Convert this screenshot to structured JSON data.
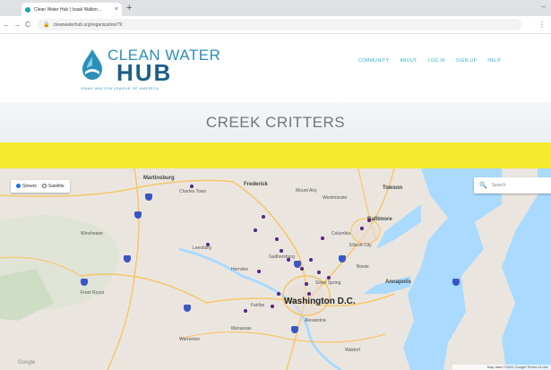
{
  "browser": {
    "tab_title": "Clean Water Hub | Izaak Walton...",
    "tab_close": "×",
    "new_tab": "+",
    "window_controls": "–",
    "url": "cleanwaterhub.org/organization/79",
    "nav_back": "←",
    "nav_forward": "→",
    "nav_reload": "C",
    "lock": "🔒",
    "menu": "⋮"
  },
  "site": {
    "logo_top": "CLEAN WATER",
    "logo_hub": "HUB",
    "logo_sub": "IZAAK WALTON LEAGUE OF AMERICA",
    "nav": [
      "COMMUNITY",
      "ABOUT",
      "LOG IN",
      "SIGN UP",
      "HELP"
    ],
    "brand_color": "#1d5f86",
    "accent_color": "#2ab0cf"
  },
  "banner": {
    "title": "CREEK CRITTERS",
    "band_color": "#f3e92e"
  },
  "map": {
    "type_options": [
      "Streets",
      "Satellite"
    ],
    "selected_type": "Streets",
    "search_placeholder": "Search",
    "search_icon": "magnifier-icon",
    "labels": {
      "martinsburg": "Martinsburg",
      "frederick": "Frederick",
      "towson": "Towson",
      "baltimore": "Baltimore",
      "columbia": "Columbia",
      "annapolis": "Annapolis",
      "washington": "Washington D.C.",
      "alexandria": "Alexandria",
      "winchester": "Winchester",
      "leesburg": "Leesburg",
      "manassas": "Manassas",
      "warrenton": "Warrenton",
      "front_royal": "Front Royal",
      "waldorf": "Waldorf",
      "charles_town": "Charles Town",
      "mount_airy": "Mount Airy",
      "westminster": "Westminster",
      "gaithersburg": "Gaithersburg",
      "bowie": "Bowie",
      "ellicott": "Ellicott City",
      "fairfax": "Fairfax",
      "herndon": "Herndon",
      "silver_spring": "Silver Spring"
    },
    "logo": "Google",
    "terms": "Map data ©2020 Google  Terms of Use",
    "pin_color": "#6a2ca0"
  }
}
